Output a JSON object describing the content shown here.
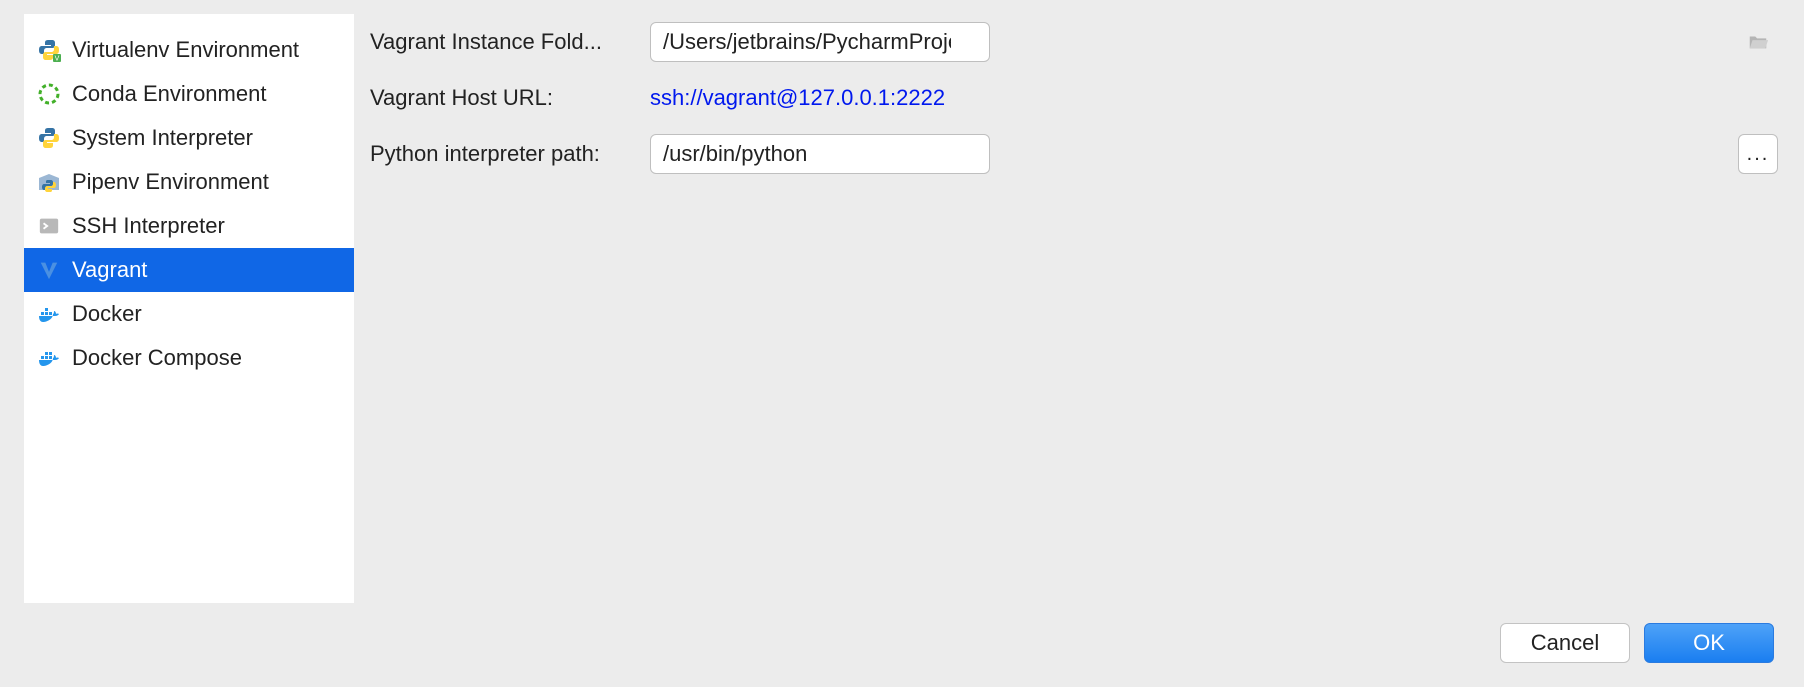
{
  "sidebar": {
    "items": [
      {
        "label": "Virtualenv Environment",
        "icon": "python-venv-icon"
      },
      {
        "label": "Conda Environment",
        "icon": "conda-icon"
      },
      {
        "label": "System Interpreter",
        "icon": "python-icon"
      },
      {
        "label": "Pipenv Environment",
        "icon": "pipenv-icon"
      },
      {
        "label": "SSH Interpreter",
        "icon": "ssh-icon"
      },
      {
        "label": "Vagrant",
        "icon": "vagrant-icon",
        "selected": true
      },
      {
        "label": "Docker",
        "icon": "docker-icon"
      },
      {
        "label": "Docker Compose",
        "icon": "docker-compose-icon"
      }
    ]
  },
  "form": {
    "instance_folder_label": "Vagrant Instance Fold...",
    "instance_folder_value": "/Users/jetbrains/PycharmProjects/MyProject",
    "host_url_label": "Vagrant Host URL:",
    "host_url_value": "ssh://vagrant@127.0.0.1:2222",
    "interpreter_path_label": "Python interpreter path:",
    "interpreter_path_value": "/usr/bin/python",
    "ellipsis": "..."
  },
  "footer": {
    "cancel_label": "Cancel",
    "ok_label": "OK"
  }
}
